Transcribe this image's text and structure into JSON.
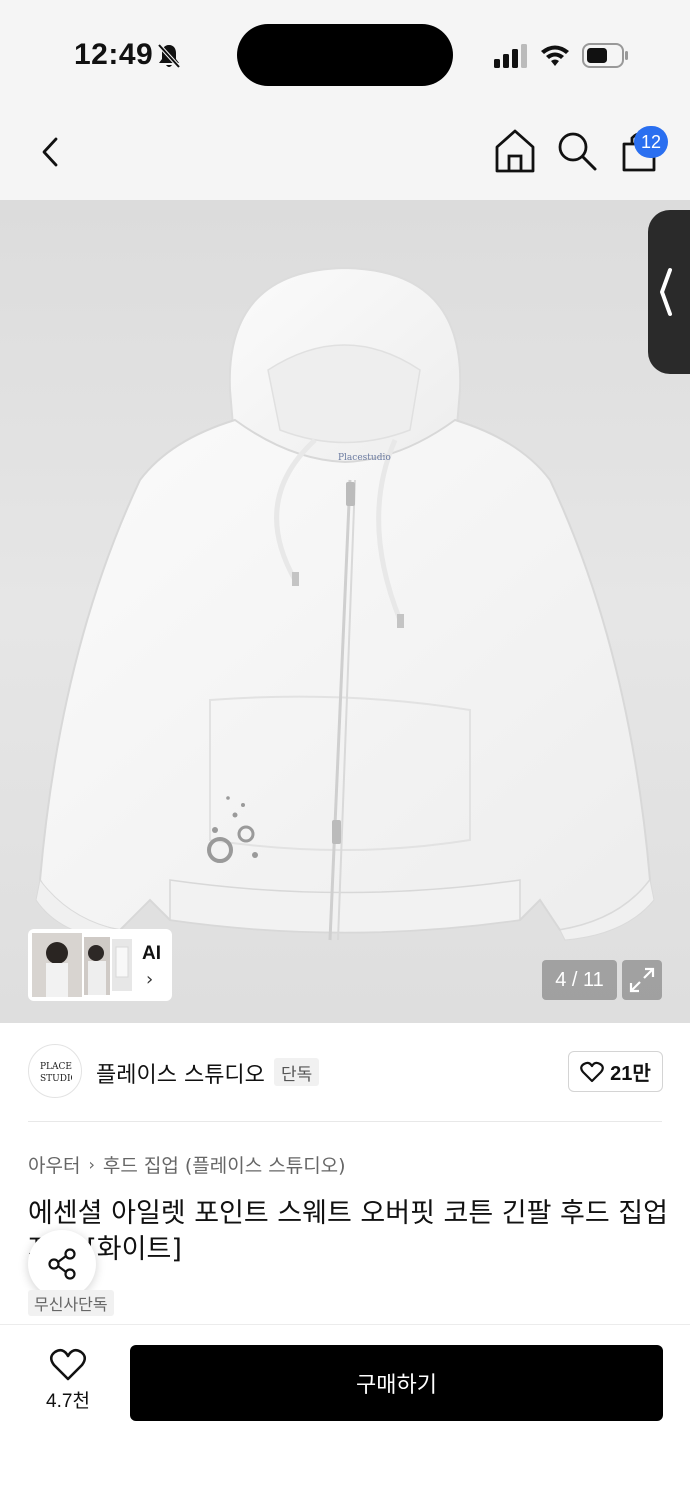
{
  "status_bar": {
    "time": "12:49",
    "icons": [
      "bell-off-icon",
      "signal-icon",
      "wifi-icon",
      "battery-icon"
    ]
  },
  "header": {
    "back_icon": "chevron-left-icon",
    "home_icon": "home-icon",
    "search_icon": "search-icon",
    "cart_icon": "shopping-bag-icon",
    "cart_badge": "12",
    "badge_color": "#2a6ff0"
  },
  "product_image": {
    "ai_label": "AI",
    "ai_chevron": "›",
    "page_indicator": "4 / 11",
    "expand_icon": "expand-icon"
  },
  "brand": {
    "name": "플레이스 스튜디오",
    "badge": "단독",
    "like_count": "21만"
  },
  "breadcrumb": {
    "category": "아우터",
    "separator": "›",
    "subcategory": "후드 집업 (플레이스 스튜디오)"
  },
  "product": {
    "title": "에센셜 아일렛 포인트 스웨트 오버핏 코튼 긴팔 후드 집업 자켓 [화이트]",
    "exclusive_tag": "무신사단독"
  },
  "bottom_bar": {
    "wish_count": "4.7천",
    "buy_label": "구매하기"
  }
}
